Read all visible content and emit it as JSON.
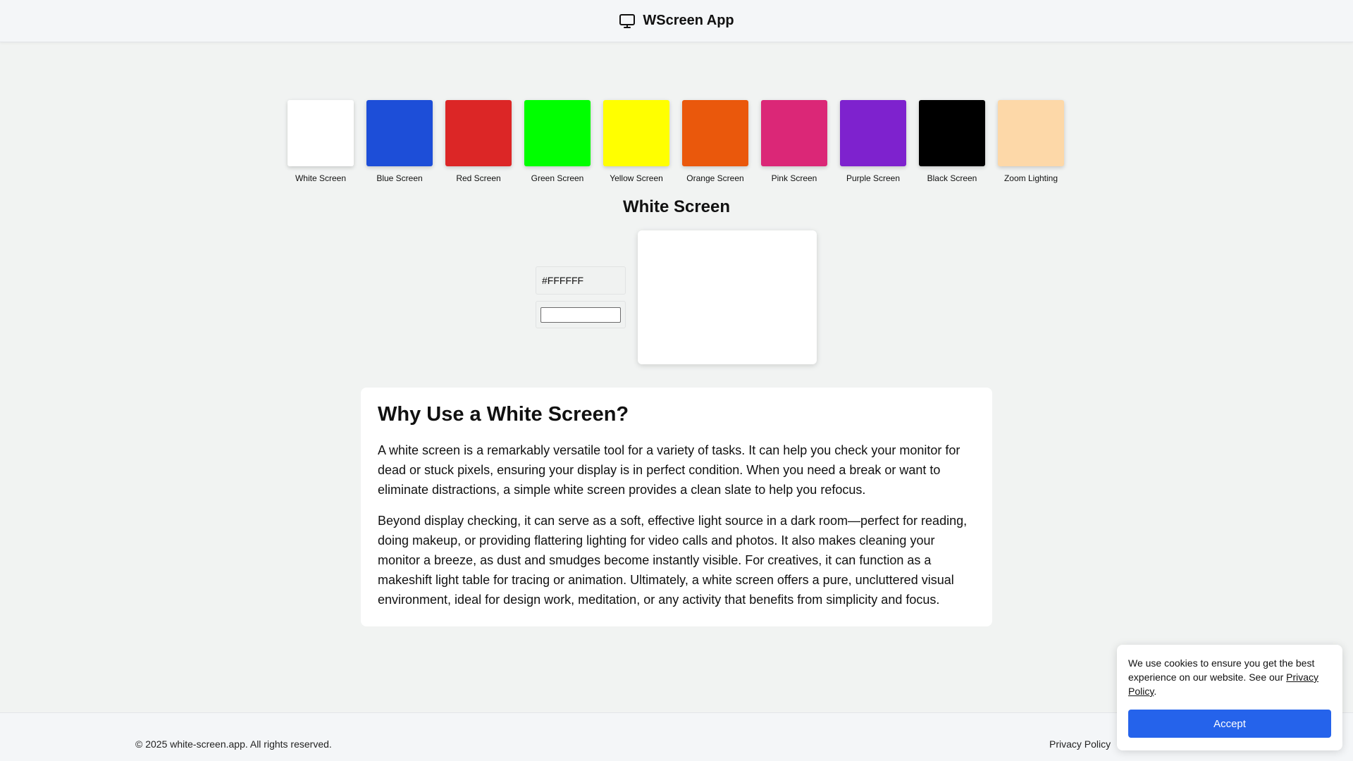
{
  "header": {
    "title": "WScreen App",
    "icon": "monitor-icon"
  },
  "swatches": [
    {
      "label": "White Screen",
      "color": "#FFFFFF"
    },
    {
      "label": "Blue Screen",
      "color": "#1D4ED8"
    },
    {
      "label": "Red Screen",
      "color": "#DC2626"
    },
    {
      "label": "Green Screen",
      "color": "#00FF00"
    },
    {
      "label": "Yellow Screen",
      "color": "#FFFF00"
    },
    {
      "label": "Orange Screen",
      "color": "#EA580C"
    },
    {
      "label": "Pink Screen",
      "color": "#DB2777"
    },
    {
      "label": "Purple Screen",
      "color": "#7E22CE"
    },
    {
      "label": "Black Screen",
      "color": "#000000"
    },
    {
      "label": "Zoom Lighting",
      "color": "#FDD8A8"
    }
  ],
  "current": {
    "title": "White Screen",
    "hex_value": "#FFFFFF",
    "preview_color": "#FFFFFF"
  },
  "article": {
    "heading": "Why Use a White Screen?",
    "paragraphs": [
      "A white screen is a remarkably versatile tool for a variety of tasks. It can help you check your monitor for dead or stuck pixels, ensuring your display is in perfect condition. When you need a break or want to eliminate distractions, a simple white screen provides a clean slate to help you refocus.",
      "Beyond display checking, it can serve as a soft, effective light source in a dark room—perfect for reading, doing makeup, or providing flattering lighting for video calls and photos. It also makes cleaning your monitor a breeze, as dust and smudges become instantly visible. For creatives, it can function as a makeshift light table for tracing or animation. Ultimately, a white screen offers a pure, uncluttered visual environment, ideal for design work, meditation, or any activity that benefits from simplicity and focus."
    ]
  },
  "footer": {
    "copyright": "© 2025 white-screen.app. All rights reserved.",
    "privacy_link": "Privacy Policy"
  },
  "cookie": {
    "text": "We use cookies to ensure you get the best experience on our website. See our ",
    "link_text": "Privacy Policy",
    "suffix": ".",
    "button_label": "Accept",
    "button_color": "#2563EB"
  }
}
